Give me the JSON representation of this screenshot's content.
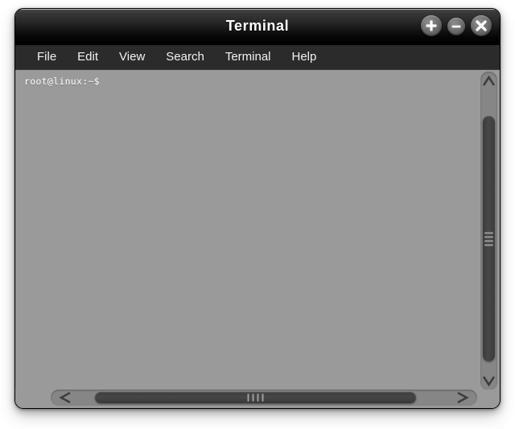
{
  "window": {
    "title": "Terminal",
    "accent_colors": {
      "titlebar_top": "#3a3a3a",
      "titlebar_bottom": "#000000",
      "menubar": "#2b2b2b",
      "terminal_background": "#9a9a9a",
      "terminal_text": "#ffffff",
      "scrollbar_trough": "#868686",
      "scrollbar_thumb": "#444444"
    },
    "controls": [
      {
        "name": "maximize-button",
        "icon": "plus-icon",
        "label": "+"
      },
      {
        "name": "minimize-button",
        "icon": "minus-icon",
        "label": "−"
      },
      {
        "name": "close-button",
        "icon": "close-x-icon",
        "label": "×"
      }
    ]
  },
  "menubar": {
    "items": [
      {
        "label": "File"
      },
      {
        "label": "Edit"
      },
      {
        "label": "View"
      },
      {
        "label": "Search"
      },
      {
        "label": "Terminal"
      },
      {
        "label": "Help"
      }
    ]
  },
  "terminal": {
    "prompt": "root@linux:~$",
    "user": "root",
    "host": "linux",
    "cwd": "~",
    "symbol": "$",
    "lines": [
      "root@linux:~$"
    ]
  },
  "scrollbars": {
    "vertical": {
      "up_arrow_icon": "chevron-up-icon",
      "down_arrow_icon": "chevron-down-icon",
      "grip_icon": "grip-lines-horizontal-icon",
      "thumb_position_percent": 15,
      "thumb_size_percent": 75
    },
    "horizontal": {
      "left_arrow_icon": "chevron-left-icon",
      "right_arrow_icon": "chevron-right-icon",
      "grip_icon": "grip-lines-vertical-icon",
      "thumb_position_percent": 10,
      "thumb_size_percent": 74
    }
  }
}
